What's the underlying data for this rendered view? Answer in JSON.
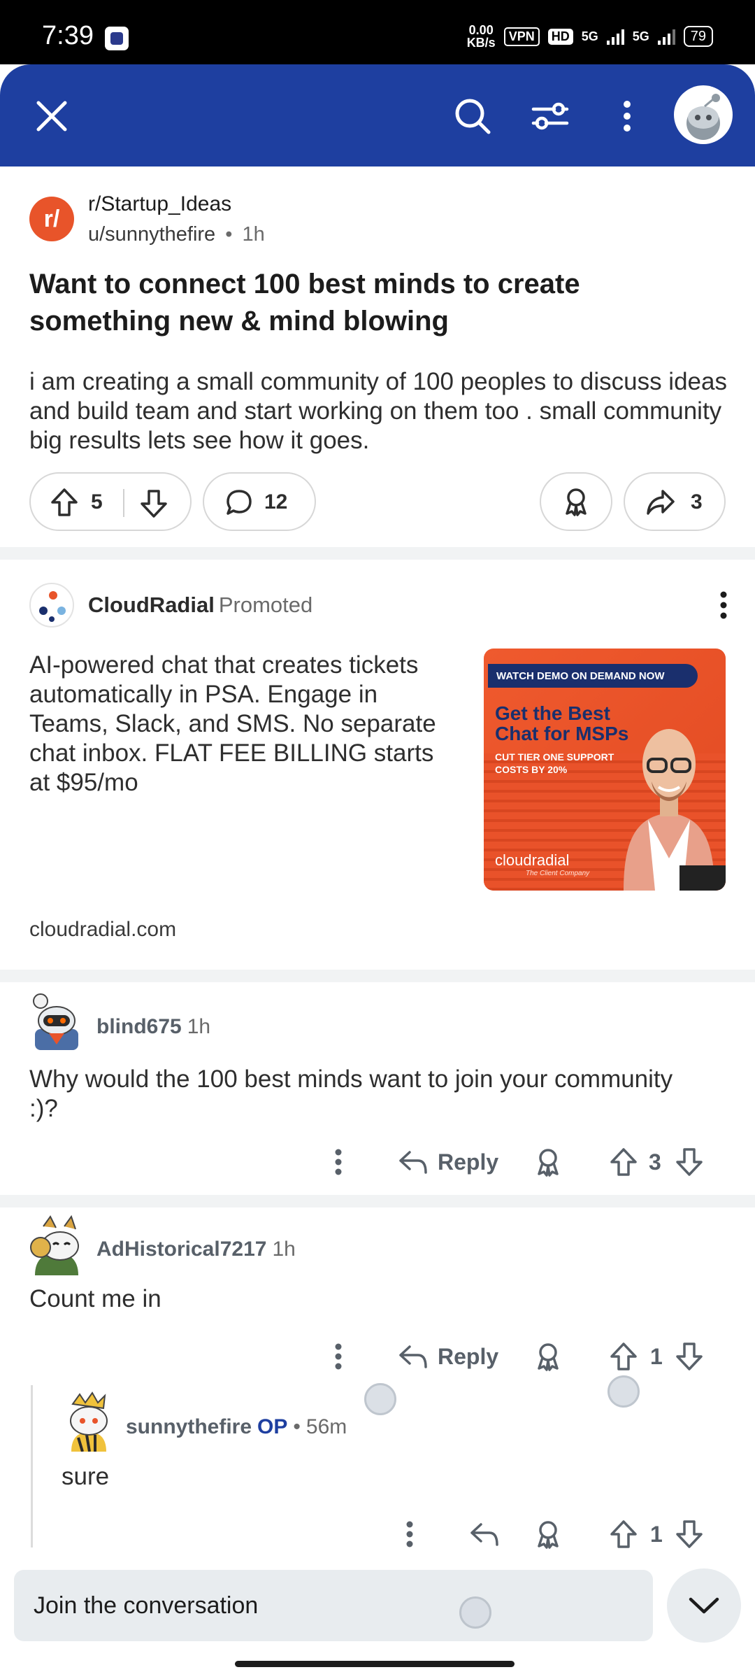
{
  "status_bar": {
    "time": "7:39",
    "speed_value": "0.00",
    "speed_unit": "KB/s",
    "vpn": "VPN",
    "hd": "HD",
    "net1": "5G",
    "net2": "5G",
    "battery": "79"
  },
  "nav": {
    "close_icon": "close-icon",
    "search_icon": "search-icon",
    "sort_icon": "sort-icon",
    "more_icon": "more-vertical-icon"
  },
  "post": {
    "subreddit": "r/Startup_Ideas",
    "subreddit_icon_letter": "r/",
    "author": "u/sunnythefire",
    "separator": "•",
    "time": "1h",
    "title": "Want to connect 100 best minds to create something new & mind blowing",
    "body": "i am creating a small community of 100 peoples to discuss ideas and build team and start working on them too . small community big results lets see how it goes.",
    "votes": "5",
    "comments": "12",
    "shares": "3"
  },
  "promoted": {
    "name": "CloudRadial",
    "tag": "Promoted",
    "text": "AI-powered chat that creates tickets automatically in PSA. Engage in Teams, Slack, and SMS. No separate chat inbox. FLAT FEE BILLING starts at $95/mo",
    "domain": "cloudradial.com",
    "image": {
      "banner": "WATCH DEMO ON DEMAND NOW",
      "headline": "Get the Best Chat for MSPs",
      "sub": "CUT TIER ONE SUPPORT COSTS BY 20%",
      "brand": "cloudradial",
      "tagline": "The Client Company"
    }
  },
  "comments": [
    {
      "author": "blind675",
      "time": "1h",
      "body": "Why would the 100 best minds want to join your community :)?",
      "reply_label": "Reply",
      "votes": "3"
    },
    {
      "author": "AdHistorical7217",
      "time": "1h",
      "body": "Count me in",
      "reply_label": "Reply",
      "votes": "1"
    },
    {
      "author": "sunnythefire",
      "op_label": "OP",
      "separator": "•",
      "time": "56m",
      "body": "sure",
      "votes": "1"
    }
  ],
  "bottom": {
    "placeholder": "Join the conversation"
  },
  "colors": {
    "nav_blue": "#1e3fa0",
    "reddit_orange": "#e8542a",
    "op_blue": "#1e3fa0"
  }
}
